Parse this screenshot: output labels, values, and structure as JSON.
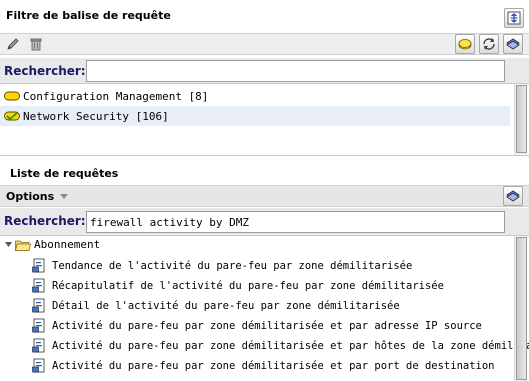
{
  "tag_filter": {
    "title": "Filtre de balise de requête",
    "search_label": "Rechercher:",
    "search_value": "",
    "tags": [
      {
        "label": "Configuration Management [8]",
        "icon": "yellow-tag-icon"
      },
      {
        "label": "Network Security [106]",
        "icon": "green-check-tag-icon"
      }
    ]
  },
  "query_list": {
    "title": "Liste de requêtes",
    "options_label": "Options",
    "search_label": "Rechercher:",
    "search_value": "firewall activity by DMZ",
    "folder": {
      "label": "Abonnement",
      "icon": "folder-icon"
    },
    "items": [
      {
        "label": "Tendance de l'activité du pare-feu par zone démilitarisée"
      },
      {
        "label": "Récapitulatif de l'activité du pare-feu par zone démilitarisée"
      },
      {
        "label": "Détail de l'activité du pare-feu par zone démilitarisée"
      },
      {
        "label": "Activité du pare-feu par zone démilitarisée et par adresse IP source"
      },
      {
        "label": "Activité du pare-feu par zone démilitarisée et par hôtes de la zone démilitarisée"
      },
      {
        "label": "Activité du pare-feu par zone démilitarisée et par port de destination"
      }
    ]
  },
  "colors": {
    "label_blue": "#1a1a66",
    "selected_row": "#e8eef7",
    "toolbar_bg": "#eeeeee"
  }
}
